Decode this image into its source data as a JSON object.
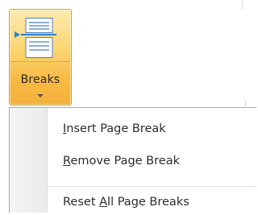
{
  "breaks_button": {
    "label": "Breaks",
    "icon": "page-breaks-icon",
    "caret": "chevron-down-icon"
  },
  "menu": {
    "items": [
      {
        "label_pre": "",
        "accel": "I",
        "label_post": "nsert Page Break"
      },
      {
        "label_pre": "",
        "accel": "R",
        "label_post": "emove Page Break"
      },
      {
        "label_pre": "Reset ",
        "accel": "A",
        "label_post": "ll Page Breaks"
      }
    ]
  },
  "colors": {
    "button_active": "#f7b942",
    "button_border": "#c6a34a",
    "menu_border": "#a7abb0",
    "icon_blue": "#2d7fd1"
  }
}
